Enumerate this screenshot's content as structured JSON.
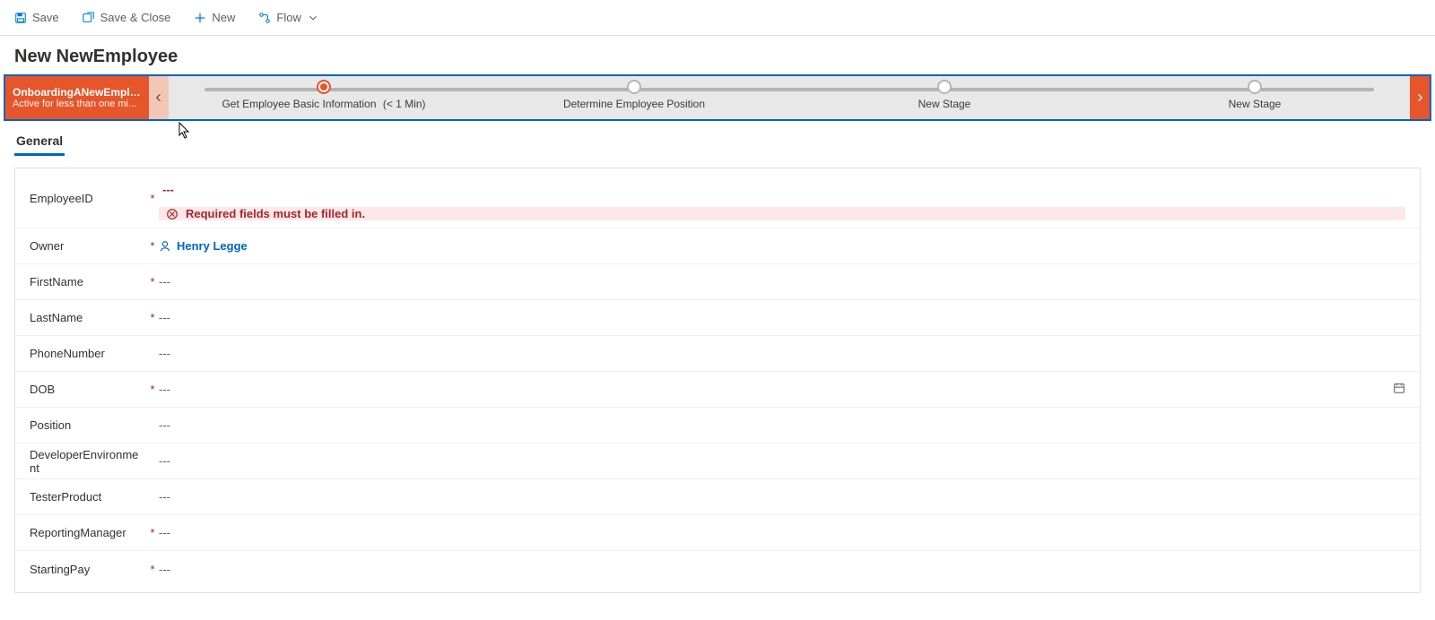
{
  "commandbar": {
    "save": "Save",
    "save_close": "Save & Close",
    "new": "New",
    "flow": "Flow"
  },
  "record": {
    "title": "New NewEmployee"
  },
  "bpf": {
    "name": "OnboardingANewEmplo...",
    "status": "Active for less than one mi...",
    "stages": [
      {
        "label": "Get Employee Basic Information",
        "duration": "(< 1 Min)",
        "active": true
      },
      {
        "label": "Determine Employee Position",
        "duration": "",
        "active": false
      },
      {
        "label": "New Stage",
        "duration": "",
        "active": false
      },
      {
        "label": "New Stage",
        "duration": "",
        "active": false
      }
    ]
  },
  "tabs": {
    "general": "General"
  },
  "form": {
    "employee_id_label": "EmployeeID",
    "employee_id_value": "---",
    "error_msg": "Required fields must be filled in.",
    "owner_label": "Owner",
    "owner_value": "Henry Legge",
    "firstname_label": "FirstName",
    "firstname_value": "---",
    "lastname_label": "LastName",
    "lastname_value": "---",
    "phone_label": "PhoneNumber",
    "phone_value": "---",
    "dob_label": "DOB",
    "dob_value": "---",
    "position_label": "Position",
    "position_value": "---",
    "devenv_label": "DeveloperEnvironment",
    "devenv_value": "---",
    "tester_label": "TesterProduct",
    "tester_value": "---",
    "manager_label": "ReportingManager",
    "manager_value": "---",
    "pay_label": "StartingPay",
    "pay_value": "---"
  },
  "required_marker": "*"
}
